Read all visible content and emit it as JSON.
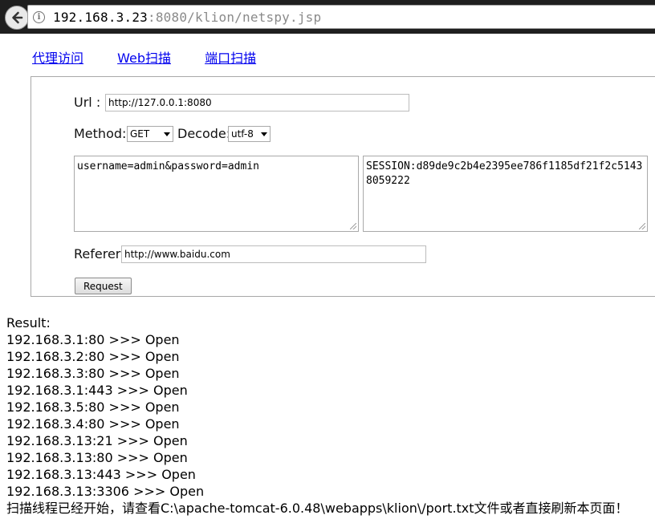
{
  "browser": {
    "url_host": "192.168.3.23",
    "url_rest": ":8080/klion/netspy.jsp"
  },
  "nav": {
    "items": [
      "代理访问",
      "Web扫描",
      "端口扫描"
    ]
  },
  "form": {
    "url_label": "Url :",
    "url_value": "http://127.0.0.1:8080",
    "method_label": "Method:",
    "method_value": "GET",
    "decode_label": "Decode:",
    "decode_value": "utf-8",
    "body_value": "username=admin&password=admin",
    "session_value": "SESSION:d89de9c2b4e2395ee786f1185df21f2c51438059222",
    "referer_label": "Referer:",
    "referer_value": "http://www.baidu.com",
    "request_button": "Request"
  },
  "results": {
    "heading": "Result:",
    "lines": [
      "192.168.3.1:80 >>> Open",
      "192.168.3.2:80 >>> Open",
      "192.168.3.3:80 >>> Open",
      "192.168.3.1:443 >>> Open",
      "192.168.3.5:80 >>> Open",
      "192.168.3.4:80 >>> Open",
      "192.168.3.13:21 >>> Open",
      "192.168.3.13:80 >>> Open",
      "192.168.3.13:443 >>> Open",
      "192.168.3.13:3306 >>> Open"
    ],
    "footer": "扫描线程已经开始，请查看C:\\apache-tomcat-6.0.48\\webapps\\klion\\/port.txt文件或者直接刷新本页面！"
  }
}
